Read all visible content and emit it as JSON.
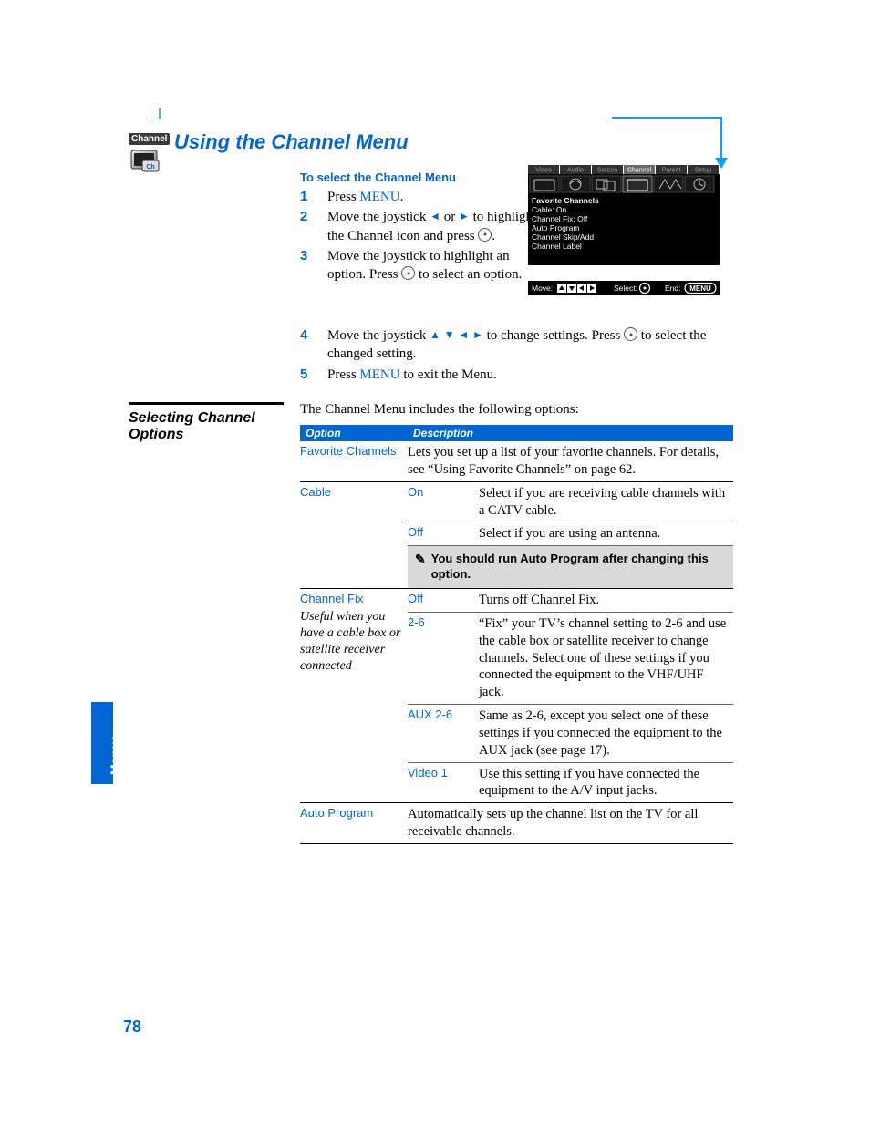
{
  "page_number": "78",
  "side_tab": "Menus",
  "badge_label": "Channel",
  "heading": "Using the Channel Menu",
  "sub_heading": "To select the Channel Menu",
  "steps": {
    "s1": {
      "num": "1",
      "pre": "Press ",
      "menu": "MENU",
      "post": "."
    },
    "s2": {
      "num": "2",
      "pre": "Move the joystick ",
      "mid": " or ",
      "post": " to highlight the Channel icon and press "
    },
    "s3": {
      "num": "3",
      "text": "Move the joystick to highlight an option. Press ",
      "post": " to select an option."
    },
    "s4": {
      "num": "4",
      "pre": "Move the joystick ",
      "mid": " to change settings. Press ",
      "post": " to select the changed setting."
    },
    "s5": {
      "num": "5",
      "pre": "Press ",
      "menu": "MENU",
      "post": " to exit the Menu."
    }
  },
  "section2_title": "Selecting Channel Options",
  "section2_intro": "The Channel Menu includes the following options:",
  "table": {
    "hdr_option": "Option",
    "hdr_desc": "Description",
    "fav_label": "Favorite Channels",
    "fav_desc": "Lets you set up a list of your favorite channels. For details, see “Using Favorite Channels” on page 62.",
    "cable_label": "Cable",
    "cable_on": "On",
    "cable_on_desc": "Select if you are receiving cable channels with a CATV cable.",
    "cable_off": "Off",
    "cable_off_desc": "Select if you are using an antenna.",
    "cable_note": "You should run Auto Program after changing this option.",
    "cf_label": "Channel Fix",
    "cf_note": "Useful when you have a cable box or satellite receiver connected",
    "cf_off": "Off",
    "cf_off_desc": "Turns off Channel Fix.",
    "cf_26": "2-6",
    "cf_26_desc": "“Fix” your TV’s channel setting to 2-6 and use the cable box or satellite receiver to change channels. Select one of these settings if you connected the equipment to the VHF/UHF jack.",
    "cf_aux": "AUX 2-6",
    "cf_aux_desc": "Same as 2-6, except you select one of these settings if you connected the equipment to the AUX jack (see page 17).",
    "cf_v1": "Video 1",
    "cf_v1_desc": "Use this setting if you have connected the equipment to the A/V input jacks.",
    "ap_label": "Auto Program",
    "ap_desc": "Automatically sets up the channel list on the TV for all receivable channels."
  },
  "osd": {
    "tabs": [
      "Video",
      "Audio",
      "Screen",
      "Channel",
      "Parent",
      "Setup"
    ],
    "items": [
      "Favorite Channels",
      "Cable: On",
      "Channel Fix: Off",
      "Auto Program",
      "Channel Skip/Add",
      "Channel Label"
    ],
    "move": "Move:",
    "select": "Select:",
    "end": "End:",
    "end_btn": "MENU"
  }
}
